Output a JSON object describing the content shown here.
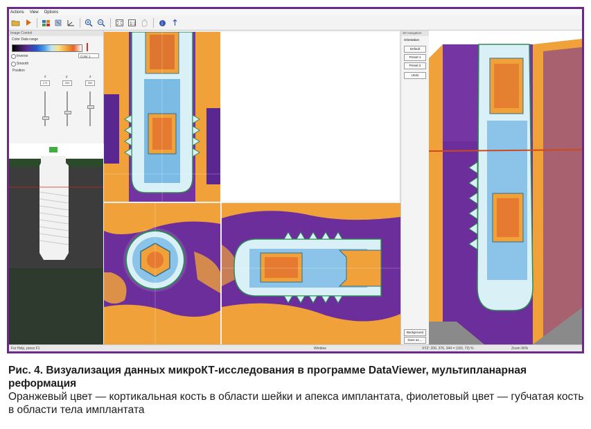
{
  "menu": [
    "Actions",
    "View",
    "Options"
  ],
  "left_panel": {
    "title": "Image Control",
    "color_group": "Color Data range",
    "inverse_label": "Inverse",
    "smooth_label": "Smooth",
    "color_select": "Color 1",
    "position_group": "Position",
    "axes": [
      "x",
      "y",
      "z"
    ],
    "positions": [
      "170",
      "263",
      "300"
    ]
  },
  "right_panel": {
    "title": "3D navigation",
    "orientation_group": "Orientation",
    "buttons": [
      "Default",
      "Preset 1",
      "Preset 2",
      "Undo"
    ],
    "bottom_buttons": [
      "Background",
      "Save as ..."
    ]
  },
  "status": {
    "left": "For Help, press F1",
    "middle": "Window",
    "right": "XYZ: 206, 376, 344 = (183, 73) %",
    "zoom": "Zoom 96%"
  },
  "caption": {
    "title": "Рис. 4. Визуализация данных микроКТ-исследования в программе DataViewer, мультипланарная реформация",
    "text": "Оранжевый цвет — кортикальная кость в области шейки и апекса имплантата, фиолетовый цвет — губчатая кость в области тела имплантата"
  },
  "colors": {
    "frame": "#6a2a86",
    "cortical": "#f2a23a",
    "trabecular": "#6b2e9a",
    "implant": "#d8f0f6"
  }
}
